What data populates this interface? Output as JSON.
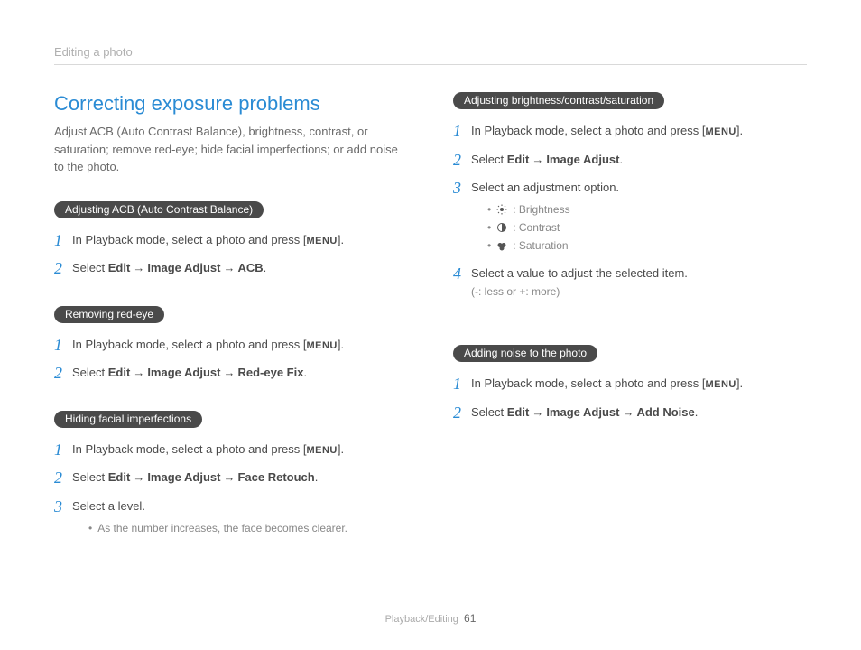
{
  "breadcrumb": "Editing a photo",
  "heading": "Correcting exposure problems",
  "intro": "Adjust ACB (Auto Contrast Balance), brightness, contrast, or saturation; remove red-eye; hide facial imperfections; or add noise to the photo.",
  "menu_label": "MENU",
  "arrow": "→",
  "left": {
    "sec1": {
      "pill": "Adjusting ACB (Auto Contrast Balance)",
      "steps": [
        {
          "pre": "In Playback mode, select a photo and press [",
          "post": "]."
        },
        {
          "text_parts": [
            "Select ",
            "Edit",
            " → ",
            "Image Adjust",
            " → ",
            "ACB",
            "."
          ]
        }
      ]
    },
    "sec2": {
      "pill": "Removing red-eye",
      "steps": [
        {
          "pre": "In Playback mode, select a photo and press [",
          "post": "]."
        },
        {
          "text_parts": [
            "Select ",
            "Edit",
            " → ",
            "Image Adjust",
            " → ",
            "Red-eye Fix",
            "."
          ]
        }
      ]
    },
    "sec3": {
      "pill": "Hiding facial imperfections",
      "steps": [
        {
          "pre": "In Playback mode, select a photo and press [",
          "post": "]."
        },
        {
          "text_parts": [
            "Select ",
            "Edit",
            " → ",
            "Image Adjust",
            " → ",
            "Face Retouch",
            "."
          ]
        },
        {
          "text": "Select a level.",
          "note": "As the number increases, the face becomes clearer."
        }
      ]
    }
  },
  "right": {
    "sec1": {
      "pill": "Adjusting brightness/contrast/saturation",
      "steps": [
        {
          "pre": "In Playback mode, select a photo and press [",
          "post": "]."
        },
        {
          "text_parts": [
            "Select ",
            "Edit",
            " → ",
            "Image Adjust",
            "."
          ]
        },
        {
          "text": "Select an adjustment option.",
          "options": [
            {
              "icon": "brightness",
              "label": ": Brightness"
            },
            {
              "icon": "contrast",
              "label": ": Contrast"
            },
            {
              "icon": "saturation",
              "label": ": Saturation"
            }
          ]
        },
        {
          "text": "Select a value to adjust the selected item.",
          "sub": "(-: less or +: more)"
        }
      ]
    },
    "sec2": {
      "pill": "Adding noise to the photo",
      "steps": [
        {
          "pre": "In Playback mode, select a photo and press [",
          "post": "]."
        },
        {
          "text_parts": [
            "Select ",
            "Edit",
            " → ",
            "Image Adjust",
            " → ",
            "Add Noise",
            "."
          ]
        }
      ]
    }
  },
  "footer": {
    "section": "Playback/Editing",
    "page": "61"
  }
}
